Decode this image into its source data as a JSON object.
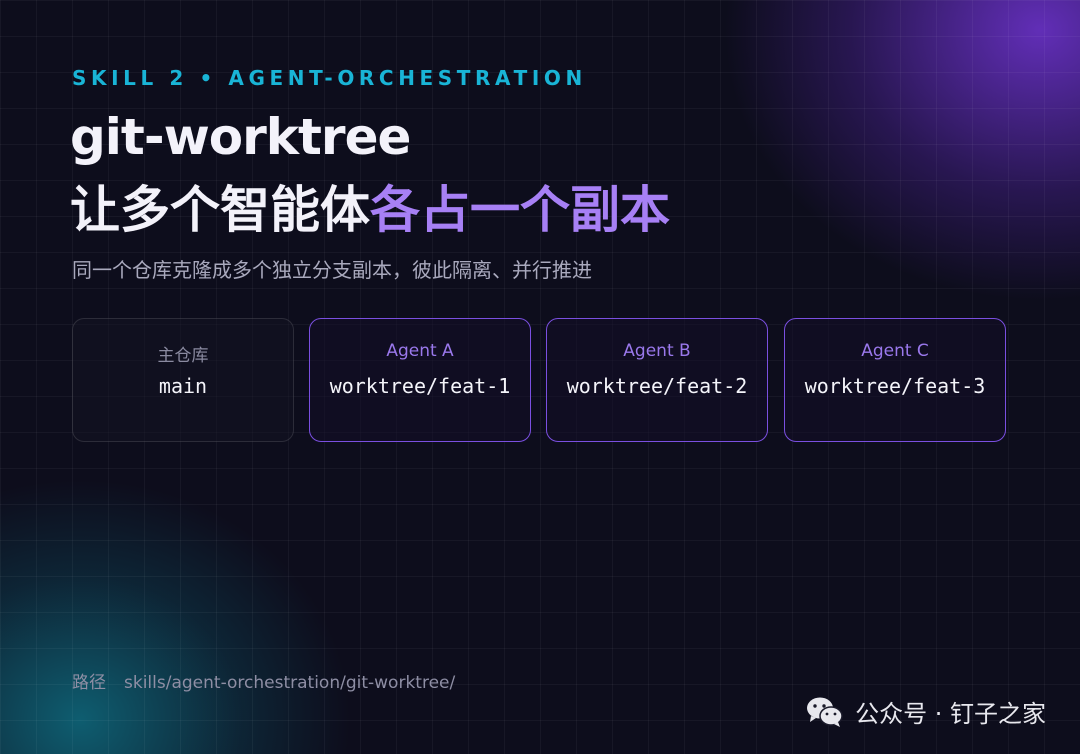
{
  "header": {
    "eyebrow": "SKILL 2 • AGENT-ORCHESTRATION",
    "title_line1": "git-worktree",
    "title_line2_plain": "让多个智能体",
    "title_line2_accent": "各占一个副本",
    "subtitle": "同一个仓库克隆成多个独立分支副本，彼此隔离、并行推进"
  },
  "cards": [
    {
      "label": "主仓库",
      "value": "main"
    },
    {
      "label": "Agent A",
      "value": "worktree/feat-1"
    },
    {
      "label": "Agent B",
      "value": "worktree/feat-2"
    },
    {
      "label": "Agent C",
      "value": "worktree/feat-3"
    }
  ],
  "footer": {
    "path_label": "路径",
    "path_value": "skills/agent-orchestration/git-worktree/"
  },
  "watermark": {
    "icon": "wechat-icon",
    "text": "公众号 · 钉子之家"
  },
  "colors": {
    "eyebrow": "#19b4d6",
    "accent": "#a780f5",
    "card_border": "#7a4fe0",
    "background": "#0d0d1c"
  }
}
